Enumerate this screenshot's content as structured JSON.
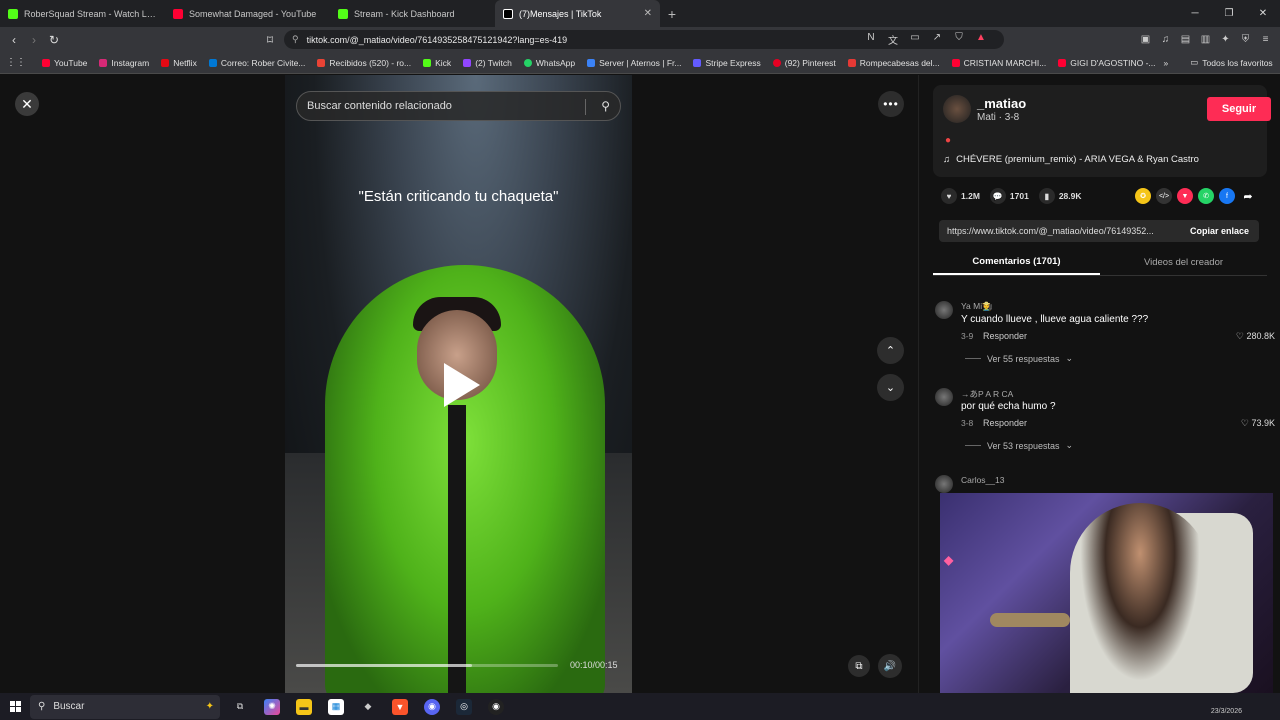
{
  "tabs": [
    {
      "title": "RoberSquad Stream - Watch Live",
      "color": "#53fc18",
      "active": false
    },
    {
      "title": "Somewhat Damaged - YouTube",
      "color": "#ff0033",
      "active": false
    },
    {
      "title": "Stream - Kick Dashboard",
      "color": "#53fc18",
      "active": false
    },
    {
      "title": "(7)Mensajes | TikTok",
      "color": "#ffffff",
      "active": true
    }
  ],
  "address": {
    "url": "tiktok.com/@_matiao/video/7614935258475121942?lang=es-419"
  },
  "bookmarks": [
    {
      "label": "YouTube",
      "color": "#ff0033"
    },
    {
      "label": "Instagram",
      "color": "#d62976"
    },
    {
      "label": "Netflix",
      "color": "#e50914"
    },
    {
      "label": "Correo: Rober Civite...",
      "color": "#0078d4"
    },
    {
      "label": "Recibidos (520) - ro...",
      "color": "#ea4335"
    },
    {
      "label": "Kick",
      "color": "#53fc18"
    },
    {
      "label": "(2) Twitch",
      "color": "#9146ff"
    },
    {
      "label": "WhatsApp",
      "color": "#25d366"
    },
    {
      "label": "Server | Aternos | Fr...",
      "color": "#3b82f6"
    },
    {
      "label": "Stripe Express",
      "color": "#635bff"
    },
    {
      "label": "(92) Pinterest",
      "color": "#e60023"
    },
    {
      "label": "Rompecabesas del...",
      "color": "#e53935"
    },
    {
      "label": "CRISTIAN MARCHI...",
      "color": "#ff0033"
    },
    {
      "label": "GIGI D'AGOSTINO -...",
      "color": "#ff0033"
    }
  ],
  "bookmarks_favorites": "Todos los favoritos",
  "video": {
    "search_placeholder": "Buscar contenido relacionado",
    "caption": "\"Están criticando tu chaqueta\"",
    "time": "00:10/00:15",
    "progress": 0.67
  },
  "creator": {
    "username": "_matiao",
    "subtitle": "Mati · 3-8",
    "follow": "Seguir",
    "music": "CHÉVERE (premium_remix) - ARIA VEGA & Ryan Castro"
  },
  "stats": {
    "likes": "1.2M",
    "comments": "1701",
    "saves": "28.9K"
  },
  "link": {
    "url": "https://www.tiktok.com/@_matiao/video/76149352...",
    "copy": "Copiar enlace"
  },
  "panel_tabs": {
    "comments": "Comentarios (1701)",
    "creator_videos": "Videos del creador"
  },
  "comments": [
    {
      "user": "Ya Mi🧑‍🌾",
      "text": "Y cuando llueve , llueve agua caliente ???",
      "date": "3-9",
      "reply": "Responder",
      "likes": "280.8K",
      "more": "Ver 55 respuestas"
    },
    {
      "user": "→あP A R CA",
      "text": "por qué echa humo ?",
      "date": "3-8",
      "reply": "Responder",
      "likes": "73.9K",
      "more": "Ver 53 respuestas"
    },
    {
      "user": "Carlos__13",
      "text": "",
      "date": "",
      "reply": "",
      "likes": "",
      "more": ""
    }
  ],
  "taskbar": {
    "search": "Buscar",
    "date": "23/3/2026"
  }
}
